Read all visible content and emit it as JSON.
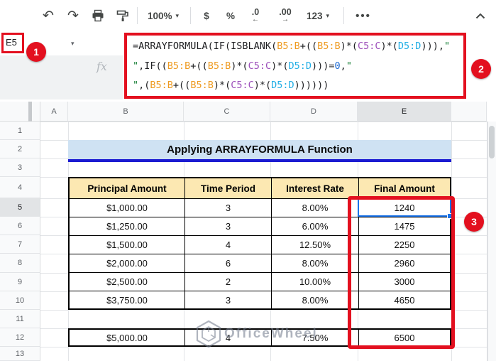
{
  "toolbar": {
    "zoom_label": "100%",
    "currency_label": "$",
    "percent_label": "%",
    "decimal_decrease": {
      "label": ".0",
      "arrow": "←"
    },
    "decimal_increase": {
      "label": ".00",
      "arrow": "→"
    },
    "number_format_label": "123",
    "more_label": "•••",
    "icons": {
      "undo": "↶",
      "redo": "↷",
      "caret": "▾"
    }
  },
  "name_box": {
    "value": "E5",
    "dropdown": "▾"
  },
  "formula_bar": {
    "fx_label": "fx",
    "lines": [
      [
        {
          "t": "=ARRAYFORMULA(IF(ISBLANK(",
          "c": "default"
        },
        {
          "t": "B5:B",
          "c": "orange"
        },
        {
          "t": "+((",
          "c": "default"
        },
        {
          "t": "B5:B",
          "c": "orange"
        },
        {
          "t": ")*(",
          "c": "default"
        },
        {
          "t": "C5:C",
          "c": "purple"
        },
        {
          "t": ")*(",
          "c": "default"
        },
        {
          "t": "D5:D",
          "c": "cyan"
        },
        {
          "t": "))),",
          "c": "default"
        },
        {
          "t": "\"",
          "c": "green"
        }
      ],
      [
        {
          "t": "\"",
          "c": "green"
        },
        {
          "t": ",IF((",
          "c": "default"
        },
        {
          "t": "B5:B",
          "c": "orange"
        },
        {
          "t": "+((",
          "c": "default"
        },
        {
          "t": "B5:B",
          "c": "orange"
        },
        {
          "t": ")*(",
          "c": "default"
        },
        {
          "t": "C5:C",
          "c": "purple"
        },
        {
          "t": ")*(",
          "c": "default"
        },
        {
          "t": "D5:D",
          "c": "cyan"
        },
        {
          "t": ")))=",
          "c": "default"
        },
        {
          "t": "0",
          "c": "blue"
        },
        {
          "t": ",",
          "c": "default"
        },
        {
          "t": "\"",
          "c": "green"
        }
      ],
      [
        {
          "t": "\"",
          "c": "green"
        },
        {
          "t": ",(",
          "c": "default"
        },
        {
          "t": "B5:B",
          "c": "orange"
        },
        {
          "t": "+((",
          "c": "default"
        },
        {
          "t": "B5:B",
          "c": "orange"
        },
        {
          "t": ")*(",
          "c": "default"
        },
        {
          "t": "C5:C",
          "c": "purple"
        },
        {
          "t": ")*(",
          "c": "default"
        },
        {
          "t": "D5:D",
          "c": "cyan"
        },
        {
          "t": "))))))",
          "c": "default"
        }
      ]
    ]
  },
  "annotations": {
    "badges": [
      "1",
      "2",
      "3"
    ]
  },
  "grid": {
    "column_headers": [
      "A",
      "B",
      "C",
      "D",
      "E"
    ],
    "row_headers": [
      "1",
      "2",
      "3",
      "4",
      "5",
      "6",
      "7",
      "8",
      "9",
      "10",
      "11",
      "12",
      "13"
    ],
    "selected_cell": "E5",
    "title": "Applying ARRAYFORMULA Function",
    "table": {
      "headers": [
        "Principal Amount",
        "Time Period",
        "Interest Rate",
        "Final Amount"
      ],
      "rows": [
        [
          "$1,000.00",
          "3",
          "8.00%",
          "1240"
        ],
        [
          "$1,250.00",
          "3",
          "6.00%",
          "1475"
        ],
        [
          "$1,500.00",
          "4",
          "12.50%",
          "2250"
        ],
        [
          "$2,000.00",
          "6",
          "8.00%",
          "2960"
        ],
        [
          "$2,500.00",
          "2",
          "10.00%",
          "3000"
        ],
        [
          "$3,750.00",
          "3",
          "8.00%",
          "4650"
        ]
      ],
      "extra_row": [
        "$5,000.00",
        "4",
        "7.50%",
        "6500"
      ]
    }
  },
  "watermark": {
    "text": "OfficeWheel"
  },
  "colors": {
    "annotation_red": "#e3101f",
    "selection_blue": "#1a73e8",
    "title_background": "#cfe2f3",
    "title_underline": "#1b1bd1",
    "table_header_fill": "#fce8b2",
    "formula_orange": "#ee9b22",
    "formula_purple": "#9d50bb",
    "formula_cyan": "#21aee5",
    "formula_green": "#188038",
    "formula_blue": "#1967d2"
  }
}
